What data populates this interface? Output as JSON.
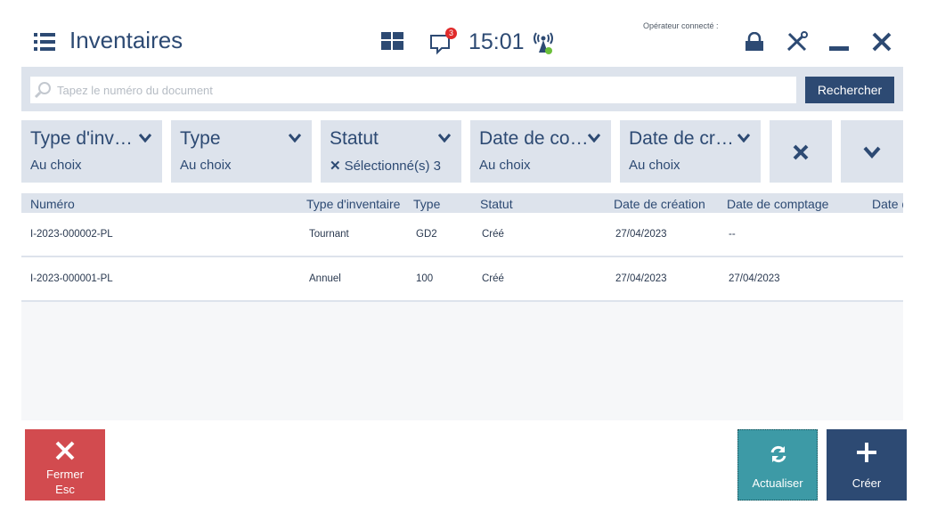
{
  "header": {
    "title": "Inventaires",
    "notification_count": "3",
    "time": "15:01",
    "operator_label": "Opérateur connecté :"
  },
  "search": {
    "placeholder": "Tapez le numéro du document",
    "button_label": "Rechercher"
  },
  "filters": [
    {
      "title": "Type d'inv…",
      "value": "Au choix"
    },
    {
      "title": "Type",
      "value": "Au choix"
    },
    {
      "title": "Statut",
      "value": "Sélectionné(s) 3"
    },
    {
      "title": "Date de co…",
      "value": "Au choix"
    },
    {
      "title": "Date de cr…",
      "value": "Au choix"
    }
  ],
  "table": {
    "columns": [
      "Numéro",
      "Type d'inventaire",
      "Type",
      "Statut",
      "Date de création",
      "Date de comptage",
      "Date d"
    ],
    "rows": [
      [
        "I-2023-000002-PL",
        "Tournant",
        "GD2",
        "Créé",
        "27/04/2023",
        "--"
      ],
      [
        "I-2023-000001-PL",
        "Annuel",
        "100",
        "Créé",
        "27/04/2023",
        "27/04/2023"
      ]
    ]
  },
  "buttons": {
    "close_line1": "Fermer",
    "close_line2": "Esc",
    "refresh": "Actualiser",
    "create": "Créer"
  },
  "colors": {
    "primary": "#2d4a73",
    "panel": "#dde3ec",
    "close": "#d24b4f",
    "refresh": "#3d9aa6",
    "badge": "#e02a2a",
    "signal_dot": "#6bbf3a"
  },
  "icons": [
    "list-icon",
    "tiles-icon",
    "message-icon",
    "signal-icon",
    "lock-icon",
    "tools-icon",
    "minimize-icon",
    "close-icon",
    "search-icon",
    "chevron-down-icon",
    "refresh-icon",
    "plus-icon"
  ]
}
